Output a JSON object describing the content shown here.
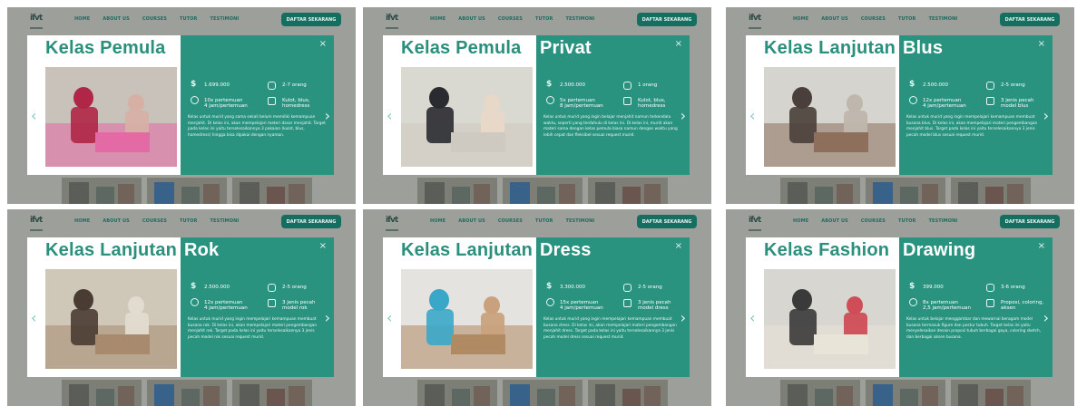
{
  "nav": {
    "logo": "ifvt",
    "links": [
      "HOME",
      "ABOUT US",
      "COURSES",
      "TUTOR",
      "TESTIMONI"
    ],
    "cta": "DAFTAR SEKARANG"
  },
  "close_glyph": "×",
  "prev_glyph": "‹",
  "next_glyph": "›",
  "accent_color": "#2a9380",
  "panels": [
    {
      "title_main": "Kelas Pemula",
      "title_accent": "",
      "price": "1.699.000",
      "meetings": "10x pertemuan",
      "duration": "4 jam/pertemuan",
      "capacity": "2-7 orang",
      "material": "Kulot, blus, homedress",
      "description": "Kelas untuk murid yang sama sekali belum memiliki kemampuan menjahit. Di kelas ini, akan mempelajari materi dasar menjahit. Target pada kelas ini yaitu terselesaikannya 3 pakaian (kulot, blus, homedress) hingga bisa dipakai dengan nyaman.",
      "photo_palette": [
        "#c8c2ba",
        "#b02647",
        "#d7b0a5",
        "#e46aa5"
      ]
    },
    {
      "title_main": "Kelas Pemula",
      "title_accent": "Privat",
      "price": "2.500.000",
      "meetings": "5x pertemuan",
      "duration": "8 jam/pertemuan",
      "capacity": "1 orang",
      "material": "Kulot, blus, homedress",
      "description": "Kelas untuk murid yang ingin belajar menjahit namun terkendala waktu, seperti yang terdahulu di kelas ini. Di kelas ini, murid akan materi sama dengan kelas pemula biasa namun dengan waktu yang lebih cepat dan fleksibel sesuai request murid.",
      "photo_palette": [
        "#d9d8d1",
        "#2a2b30",
        "#e8d8c8",
        "#cfcac1"
      ]
    },
    {
      "title_main": "Kelas Lanjutan",
      "title_accent": "Blus",
      "price": "2.500.000",
      "meetings": "12x pertemuan",
      "duration": "4 jam/pertemuan",
      "capacity": "2-5 orang",
      "material": "3 jenis pecah model blus",
      "description": "Kelas untuk murid yang ingin mempelajari kemampuan membuat busana blus. Di kelas ini, akan mempelajari materi pengembangan menjahit blus. Target pada kelas ini yaitu terselesaikannya 3 jenis pecah model blus sesuai request murid.",
      "photo_palette": [
        "#d6d4ce",
        "#4a3f3a",
        "#bfb6ad",
        "#8d6f5c"
      ]
    },
    {
      "title_main": "Kelas Lanjutan",
      "title_accent": "Rok",
      "price": "2.500.000",
      "meetings": "12x pertemuan",
      "duration": "4 jam/pertemuan",
      "capacity": "2-5 orang",
      "material": "3 jenis pecah model rok",
      "description": "Kelas untuk murid yang ingin mempelajari kemampuan membuat busana rok. Di kelas ini, akan mempelajari materi pengembangan menjahit rok. Target pada kelas ini yaitu terselesaikannya 3 jenis pecah model rok sesuai request murid.",
      "photo_palette": [
        "#cfc7b8",
        "#4a3c33",
        "#e2dbd0",
        "#a88a6f"
      ]
    },
    {
      "title_main": "Kelas Lanjutan",
      "title_accent": "Dress",
      "price": "3.300.000",
      "meetings": "15x pertemuan",
      "duration": "4 jam/pertemuan",
      "capacity": "2-5 orang",
      "material": "3 jenis pecah model dress",
      "description": "Kelas untuk murid yang ingin mempelajari kemampuan membuat busana dress. Di kelas ini, akan mempelajari materi pengembangan menjahit dress. Target pada kelas ini yaitu terselesaikannya 3 jenis pecah model dress sesuai request murid.",
      "photo_palette": [
        "#e5e3df",
        "#3aa7c9",
        "#c9a27d",
        "#b08a63"
      ]
    },
    {
      "title_main": "Kelas Fashion",
      "title_accent": "Drawing",
      "price": "399.000",
      "meetings": "8x pertemuan",
      "duration": "2,5 jam/pertemuan",
      "capacity": "3-6 orang",
      "material": "Proposi, coloring, aksen",
      "description": "Kelas untuk belajar menggambar dan mewarnai beragam model busana termasuk figure dan postur tubuh. Target kelas ini yaitu menyelesaikan desain proposi tubuh berbagai gaya, coloring sketch, dan berbagai aksen busana.",
      "photo_palette": [
        "#d8d6d0",
        "#3b3a3a",
        "#cf4d57",
        "#e9e4d8"
      ]
    }
  ]
}
